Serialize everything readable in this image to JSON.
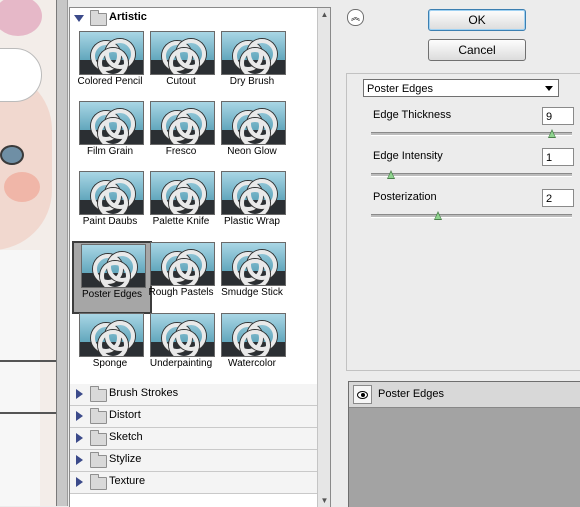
{
  "buttons": {
    "ok": "OK",
    "cancel": "Cancel"
  },
  "gallery": {
    "open_category": "Artistic",
    "filters": [
      "Colored Pencil",
      "Cutout",
      "Dry Brush",
      "Film Grain",
      "Fresco",
      "Neon Glow",
      "Paint Daubs",
      "Palette Knife",
      "Plastic Wrap",
      "Poster Edges",
      "Rough Pastels",
      "Smudge Stick",
      "Sponge",
      "Underpainting",
      "Watercolor"
    ],
    "selected_filter": "Poster Edges",
    "categories": [
      "Brush Strokes",
      "Distort",
      "Sketch",
      "Stylize",
      "Texture"
    ]
  },
  "settings": {
    "filter_select": "Poster Edges",
    "params": [
      {
        "label": "Edge Thickness",
        "value": "9",
        "min": 0,
        "max": 10
      },
      {
        "label": "Edge Intensity",
        "value": "1",
        "min": 0,
        "max": 10
      },
      {
        "label": "Posterization",
        "value": "2",
        "min": 0,
        "max": 6
      }
    ]
  },
  "layers": {
    "active_layer": "Poster Edges"
  },
  "icons": {
    "collapse": "double-chevron-up-icon",
    "expanded": "triangle-down-icon",
    "collapsed": "triangle-right-icon",
    "folder": "folder-icon",
    "visibility": "eye-icon",
    "dropdown": "dropdown-arrow-icon"
  },
  "colors": {
    "ok_border": "#3c7fb1",
    "selected_thumb": "#a6a6a6",
    "slider": "#4b7f4b"
  }
}
